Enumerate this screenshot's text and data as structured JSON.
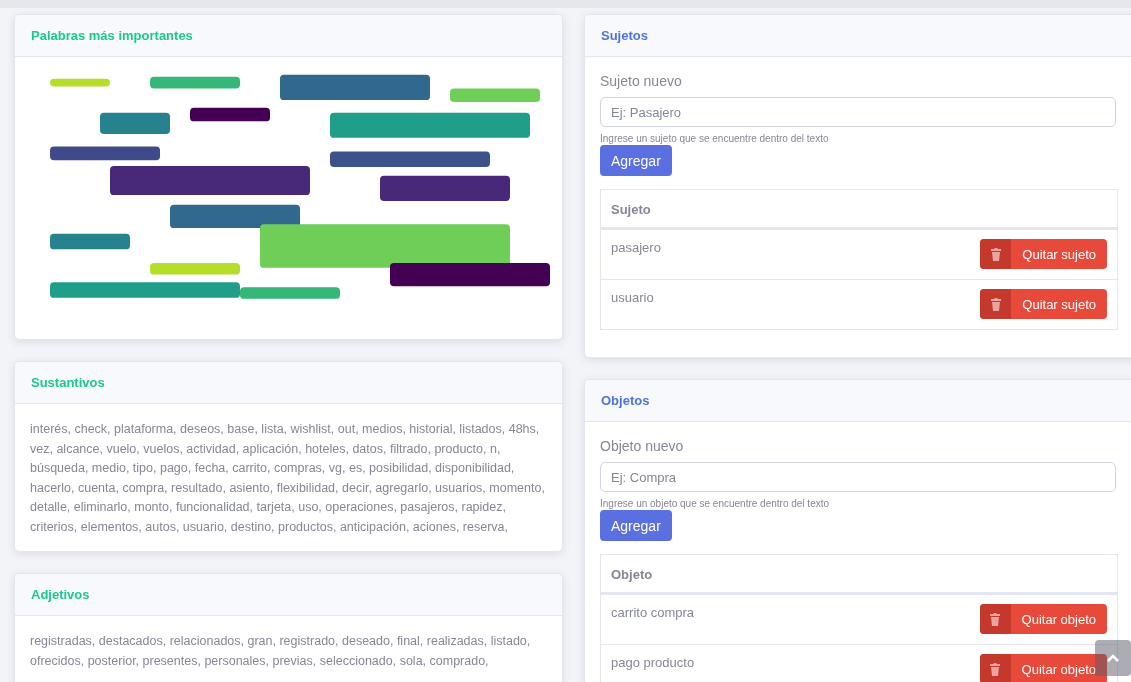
{
  "left_cards": [
    {
      "kind": "picture",
      "title": "Palabras más importantes"
    },
    {
      "kind": "text",
      "title": "Sustantivos",
      "text": "interés, check, plataforma, deseos, base, lista, wishlist, out, medios, historial, listados, 48hs, vez, alcance, vuelo, vuelos, actividad, aplicación, hoteles, datos, filtrado, producto, n, búsqueda, medio, tipo, pago, fecha, carrito, compras, vg, es, posibilidad, disponibilidad, hacerlo, cuenta, compra, resultado, asiento, flexibilidad, decir, agregarlo, usuarios, momento, detalle, eliminarlo, monto, funcionalidad, tarjeta, uso, operaciones, pasajeros, rapidez, criterios, elementos, autos, usuario, destino, productos, anticipación, aciones, reserva,"
    },
    {
      "kind": "text",
      "title": "Adjetivos",
      "text": "registradas, destacados, relacionados, gran, registrado, deseado, final, realizadas, listado, ofrecidos, posterior, presentes, personales, previas, seleccionado, sola, comprado,"
    }
  ],
  "right_cards": [
    {
      "title": "Sujetos",
      "field_label": "Sujeto nuevo",
      "placeholder": "Ej: Pasajero",
      "help": "Ingrese un sujeto que se encuentre dentro del texto",
      "add_button": "Agregar",
      "column": "Sujeto",
      "rows": [
        {
          "name": "pasajero",
          "button": "Quitar sujeto"
        },
        {
          "name": "usuario",
          "button": "Quitar sujeto"
        }
      ]
    },
    {
      "title": "Objetos",
      "field_label": "Objeto nuevo",
      "placeholder": "Ej: Compra",
      "help": "Ingrese un objeto que se encuentre dentro del texto",
      "add_button": "Agregar",
      "column": "Objeto",
      "rows": [
        {
          "name": "carrito compra",
          "button": "Quitar objeto"
        },
        {
          "name": "pago producto",
          "button": "Quitar objeto"
        }
      ]
    }
  ]
}
